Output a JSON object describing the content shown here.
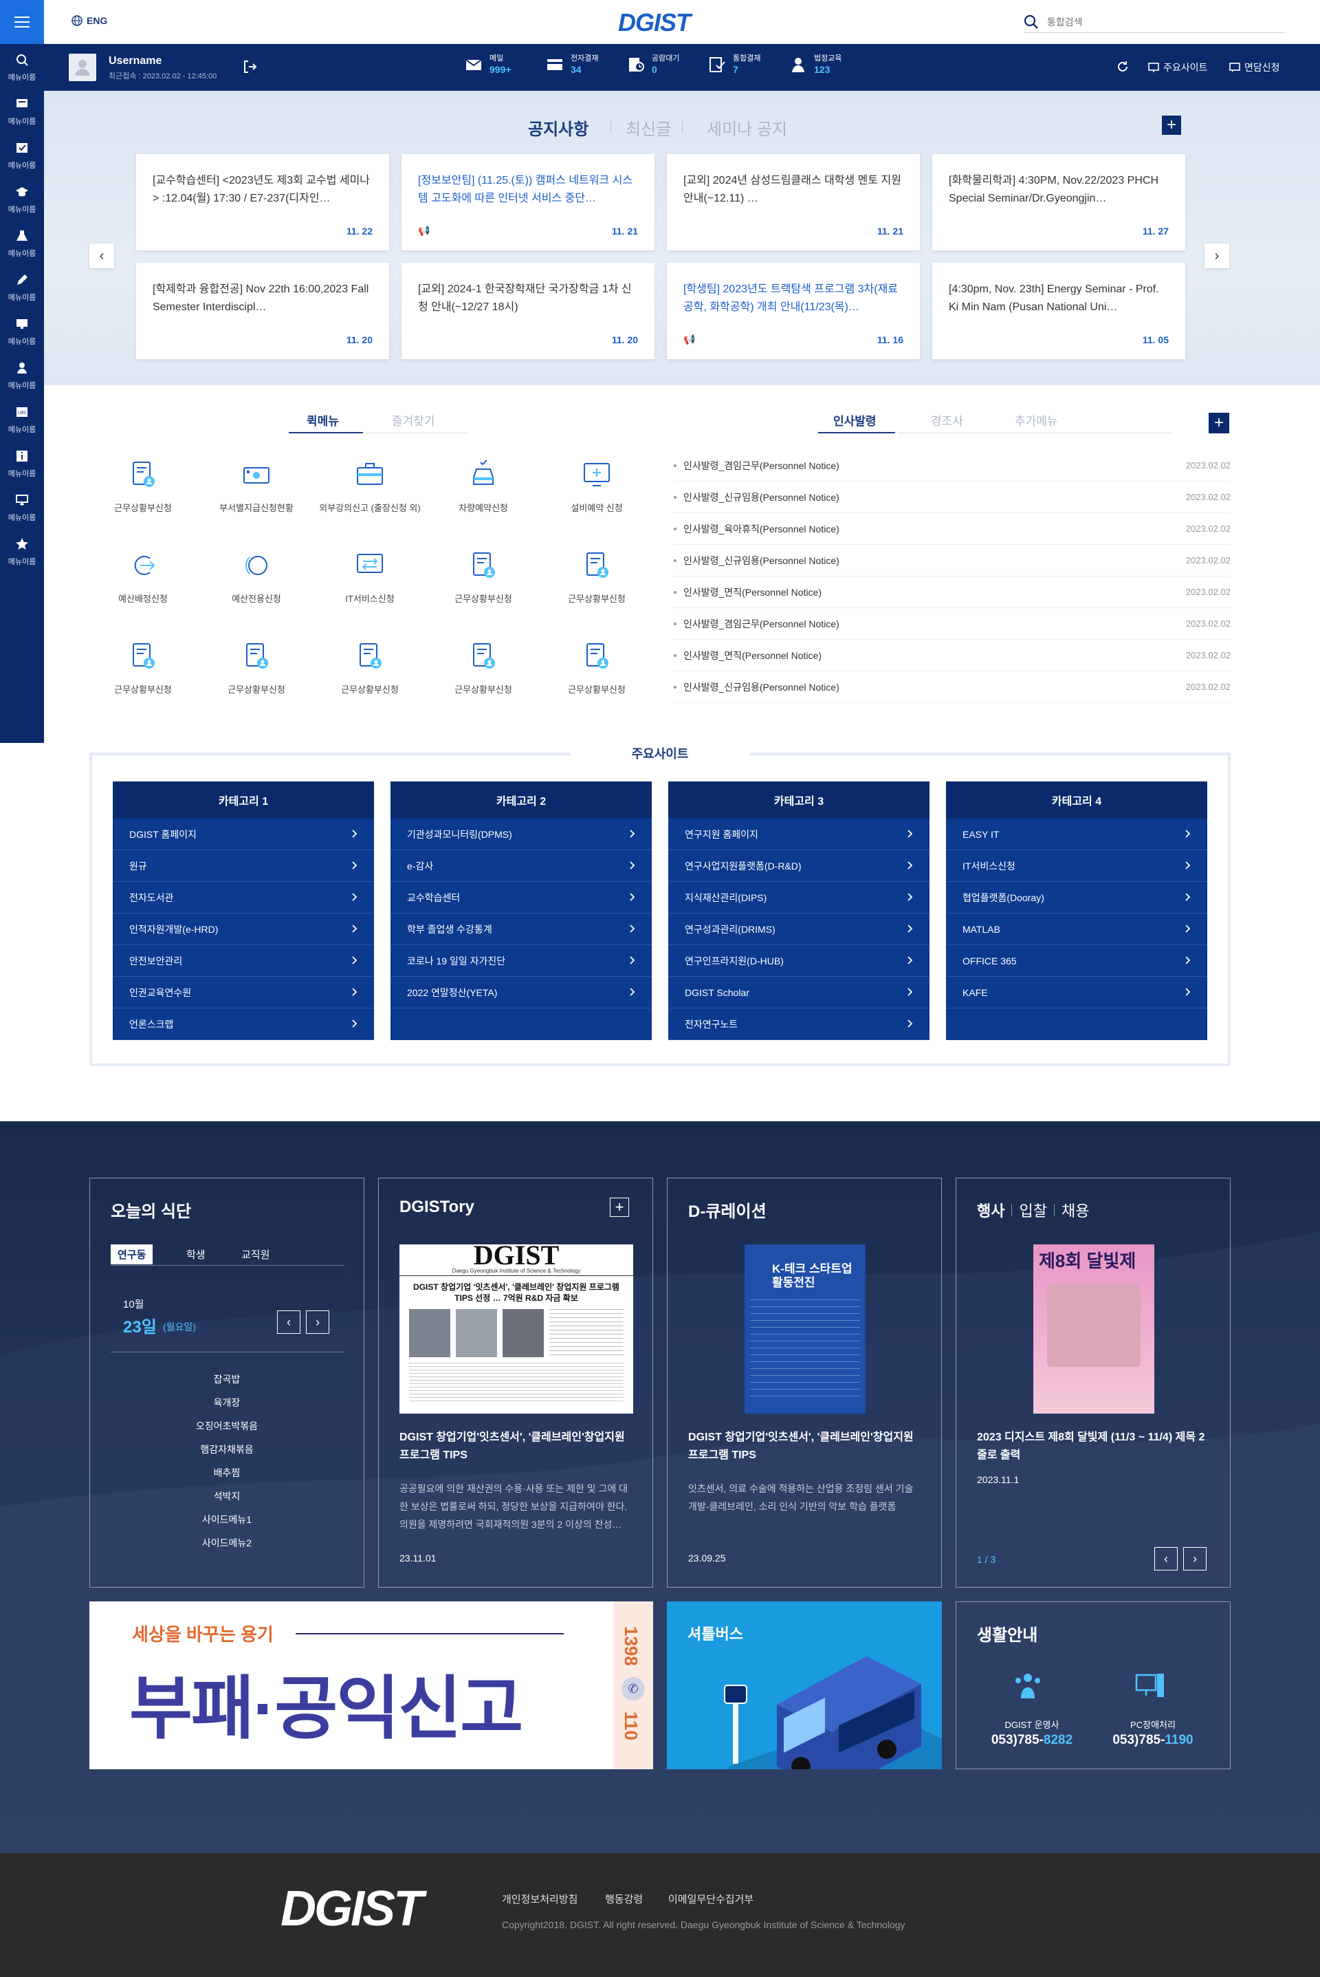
{
  "app": {
    "logo": "DGIST",
    "lang": "ENG",
    "search_placeholder": "통합검색"
  },
  "rail": {
    "menu_icon": "hamburger-icon",
    "items": [
      {
        "icon": "search-icon",
        "label": "메뉴이름"
      },
      {
        "icon": "board-icon",
        "label": "메뉴이름"
      },
      {
        "icon": "approval-icon",
        "label": "메뉴이름"
      },
      {
        "icon": "graduation-icon",
        "label": "메뉴이름"
      },
      {
        "icon": "flask-icon",
        "label": "메뉴이름"
      },
      {
        "icon": "pen-icon",
        "label": "메뉴이름"
      },
      {
        "icon": "monitor-icon",
        "label": "메뉴이름"
      },
      {
        "icon": "person-icon",
        "label": "메뉴이름"
      },
      {
        "icon": "lms-icon",
        "label": "메뉴이름"
      },
      {
        "icon": "info-icon",
        "label": "메뉴이름"
      },
      {
        "icon": "window-add-icon",
        "label": "메뉴이름"
      },
      {
        "icon": "star-icon",
        "label": "메뉴이름"
      }
    ]
  },
  "user": {
    "name": "Username",
    "last_login": "최근접속 : 2023.02.02 - 12:45:00"
  },
  "stats": [
    {
      "label": "메일",
      "value": "999+"
    },
    {
      "label": "전자결재",
      "value": "34"
    },
    {
      "label": "공람대기",
      "value": "0"
    },
    {
      "label": "통합결재",
      "value": "7"
    },
    {
      "label": "법정교육",
      "value": "123"
    }
  ],
  "userbar_links": {
    "refresh": "refresh-icon",
    "sites": "주요사이트",
    "consult": "면담신청"
  },
  "notice": {
    "tabs": [
      "공지사항",
      "최신글",
      "세미나 공지"
    ],
    "cards": [
      {
        "title": "[교수학습센터] <2023년도 제3회 교수법 세미나> :12.04(월) 17:30 / E7-237(디자인…",
        "date": "11. 22",
        "blue": false,
        "pin": false
      },
      {
        "title": "[정보보안팀] (11.25.(토)) 캠퍼스 네트워크 시스템 고도화에 따른 인터넷 서비스 중단…",
        "date": "11. 21",
        "blue": true,
        "pin": true
      },
      {
        "title": "[교외] 2024년 삼성드림클래스 대학생 멘토 지원 안내(~12.11) …",
        "date": "11. 21",
        "blue": false,
        "pin": false
      },
      {
        "title": "[화학물리학과] 4:30PM, Nov.22/2023 PHCH Special Seminar/Dr.Gyeongjin…",
        "date": "11. 27",
        "blue": false,
        "pin": false
      },
      {
        "title": "[학제학과 융합전공] Nov 22th 16:00,2023 Fall Semester Interdiscipl…",
        "date": "11. 20",
        "blue": false,
        "pin": false
      },
      {
        "title": "[교외] 2024-1 한국장학재단 국가장학금 1차 신청 안내(~12/27 18시)",
        "date": "11. 20",
        "blue": false,
        "pin": false
      },
      {
        "title": "[학생팀] 2023년도 트랙탐색 프로그램 3차(재료공학, 화학공학) 개최 안내(11/23(목)…",
        "date": "11. 16",
        "blue": true,
        "pin": true
      },
      {
        "title": "[4:30pm, Nov. 23th] Energy Seminar - Prof. Ki Min Nam (Pusan National Uni…",
        "date": "11. 05",
        "blue": false,
        "pin": false
      }
    ]
  },
  "quick": {
    "tabs": [
      "퀵메뉴",
      "즐겨찾기"
    ],
    "items": [
      {
        "icon": "doc-person-icon",
        "label": "근무상황부신청"
      },
      {
        "icon": "money-icon",
        "label": "부서별지급신청현황"
      },
      {
        "icon": "briefcase-icon",
        "label": "외부강의신고 (출장신청 외)"
      },
      {
        "icon": "car-icon",
        "label": "차량예약신청"
      },
      {
        "icon": "monitor-plus-icon",
        "label": "설비예약 신청"
      },
      {
        "icon": "arrow-circle-icon",
        "label": "예산배정신청"
      },
      {
        "icon": "circle-icon",
        "label": "예산전용신청"
      },
      {
        "icon": "it-service-icon",
        "label": "IT서비스신청"
      },
      {
        "icon": "doc-person-icon",
        "label": "근무상황부신청"
      },
      {
        "icon": "doc-person-icon",
        "label": "근무상황부신청"
      },
      {
        "icon": "doc-person-icon",
        "label": "근무상황부신청"
      },
      {
        "icon": "doc-person-icon",
        "label": "근무상황부신청"
      },
      {
        "icon": "doc-person-icon",
        "label": "근무상황부신청"
      },
      {
        "icon": "doc-person-icon",
        "label": "근무상황부신청"
      },
      {
        "icon": "doc-person-icon",
        "label": "근무상황부신청"
      }
    ]
  },
  "personnel": {
    "tabs": [
      "인사발령",
      "경조사",
      "추가메뉴"
    ],
    "rows": [
      {
        "title": "인사발령_겸임근무(Personnel Notice)",
        "date": "2023.02.02"
      },
      {
        "title": "인사발령_신규임용(Personnel Notice)",
        "date": "2023.02.02"
      },
      {
        "title": "인사발령_육아휴직(Personnel Notice)",
        "date": "2023.02.02"
      },
      {
        "title": "인사발령_신규임용(Personnel Notice)",
        "date": "2023.02.02"
      },
      {
        "title": "인사발령_면직(Personnel Notice)",
        "date": "2023.02.02"
      },
      {
        "title": "인사발령_겸임근무(Personnel Notice)",
        "date": "2023.02.02"
      },
      {
        "title": "인사발령_면직(Personnel Notice)",
        "date": "2023.02.02"
      },
      {
        "title": "인사발령_신규임용(Personnel Notice)",
        "date": "2023.02.02"
      }
    ]
  },
  "sites": {
    "title": "주요사이트",
    "columns": [
      {
        "header": "카테고리 1",
        "items": [
          "DGIST 홈페이지",
          "원규",
          "전자도서관",
          "인적자원개발(e-HRD)",
          "안전보안관리",
          "인권교육연수원",
          "언론스크랩"
        ]
      },
      {
        "header": "카테고리 2",
        "items": [
          "기관성과모니터링(DPMS)",
          "e-감사",
          "교수학습센터",
          "학부 졸업생 수강통계",
          "코로나 19 일일 자가진단",
          "2022 연말정산(YETA)"
        ]
      },
      {
        "header": "카테고리 3",
        "items": [
          "연구지원 홈페이지",
          "연구사업지원플랫폼(D-R&D)",
          "지식재산관리(DIPS)",
          "연구성과관리(DRIMS)",
          "연구인프라지원(D-HUB)",
          "DGIST Scholar",
          "전자연구노트"
        ]
      },
      {
        "header": "카테고리 4",
        "items": [
          "EASY IT",
          "IT서비스신청",
          "협업플랫폼(Dooray)",
          "MATLAB",
          "OFFICE 365",
          "KAFE"
        ]
      }
    ]
  },
  "meal": {
    "title": "오늘의 식단",
    "tabs": [
      "연구동",
      "학생",
      "교직원"
    ],
    "month": "10월",
    "day": "23일",
    "weekday": "(월요일)",
    "items": [
      "잡곡밥",
      "육개장",
      "오징어초박볶음",
      "햄감자채볶음",
      "배추찜",
      "석박지",
      "사이드메뉴1",
      "사이드메뉴2"
    ]
  },
  "story": {
    "title": "DGISTory",
    "img_masthead": "DGIST",
    "img_sub": "Daegu Gyeongbuk Institute of Science & Technology",
    "img_headline": "DGIST 창업기업 '잇츠센서', '클레브레인' 창업지원 프로그램 TIPS 선정 … 7억원 R&D 자금 확보",
    "headline": "DGIST 창업기업'잇츠센서', '클레브레인'창업지원 프로그램 TIPS",
    "desc": "공공필요에 의한 재산권의 수용·사용 또는 제한 및 그에 대한 보상은 법률로써 하되, 정당한 보상을 지급하여야 한다. 의원을 제명하려면 국회재적의원 3분의 2 이상의 찬성…",
    "date": "23.11.01"
  },
  "curation": {
    "title": "D-큐레이션",
    "img_title": "K-테크 스타트업 활동전진",
    "headline": "DGIST 창업기업'잇츠센서', '클레브레인'창업지원 프로그램 TIPS",
    "desc": "잇츠센서, 의료 수술에 적용하는 산업용 조정림 센서 기술 개발-클레브레인, 소리 인식 기반의 악보 학습 플랫폼",
    "date": "23.09.25"
  },
  "event": {
    "tabs": [
      "행사",
      "입찰",
      "채용"
    ],
    "poster": "제8회 달빛제",
    "headline": "2023 디지스트 제8회 달빛제 (11/3 ~ 11/4) 제목 2줄로 출력",
    "date": "2023.11.1",
    "page": "1 / 3"
  },
  "report": {
    "tagline": "세상을 바꾸는 용기",
    "title": "부패·공익신고",
    "phone_a": "1398",
    "phone_b": "110"
  },
  "shuttle": {
    "title": "셔틀버스"
  },
  "life": {
    "title": "생활안내",
    "items": [
      {
        "icon": "people-icon",
        "label": "DGIST 운영사",
        "phone": "053)785-",
        "phone_hl": "8282"
      },
      {
        "icon": "pc-icon",
        "label": "PC장애처리",
        "phone": "053)785-",
        "phone_hl": "1190"
      }
    ]
  },
  "footer": {
    "logo": "DGIST",
    "links": [
      "개인정보처리방침",
      "행동강령",
      "이메일무단수집거부"
    ],
    "copyright": "Copyright2018. DGIST. All right reserved. Daegu Gyeongbuk Institute of Science & Technology"
  },
  "colors": {
    "navy": "#0b2a6b",
    "blue": "#1a5fc9",
    "cyan": "#4fc3ff",
    "dark_bg": "#1f2e52"
  }
}
